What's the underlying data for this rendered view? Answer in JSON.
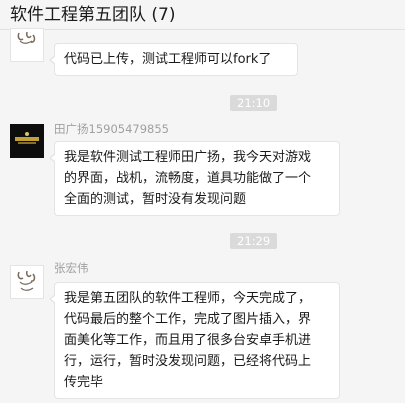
{
  "header": {
    "title": "软件工程第五团队 (7)"
  },
  "messages": [
    {
      "sender": "",
      "avatar_icon": "sketch-avatar-icon",
      "lines": [
        "代码已上传，测试工程师可以fork了"
      ]
    },
    {
      "time": "21:10"
    },
    {
      "sender": "田广扬15905479855",
      "avatar_icon": "dark-photo-avatar-icon",
      "lines": [
        "我是软件测试工程师田广扬，我今天对游戏",
        "的界面，战机，流畅度，道具功能做了一个",
        "全面的测试，暂时没有发现问题"
      ]
    },
    {
      "time": "21:29"
    },
    {
      "sender": "张宏伟",
      "avatar_icon": "sketch-avatar-icon",
      "lines": [
        "我是第五团队的软件工程师，今天完成了，",
        "代码最后的整个工作，完成了图片插入，界",
        "面美化等工作，而且用了很多台安卓手机进",
        "行，运行，暂时没发现问题，已经将代码上",
        "传完毕"
      ]
    }
  ]
}
